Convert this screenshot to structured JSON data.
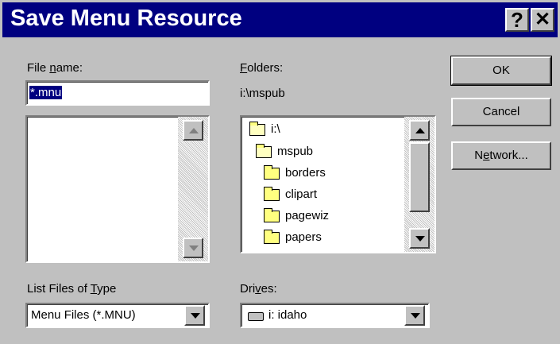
{
  "window": {
    "title": "Save Menu Resource",
    "help_glyph": "?",
    "close_glyph": "✕"
  },
  "file_name": {
    "label_pre": "File ",
    "label_u": "n",
    "label_post": "ame:",
    "value": "*.mnu",
    "files": []
  },
  "folders": {
    "label_u": "F",
    "label_post": "olders:",
    "current_path": "i:\\mspub",
    "items": [
      "i:\\",
      "mspub",
      "borders",
      "clipart",
      "pagewiz",
      "papers"
    ]
  },
  "list_type": {
    "label_pre": "List Files of ",
    "label_u": "T",
    "label_post": "ype",
    "value": "Menu Files (*.MNU)"
  },
  "drives": {
    "label_pre": "Dri",
    "label_u": "v",
    "label_post": "es:",
    "value": "i: idaho"
  },
  "buttons": {
    "ok": "OK",
    "cancel": "Cancel",
    "network_pre": "N",
    "network_u": "e",
    "network_post": "twork..."
  },
  "colors": {
    "title_bg": "#000080",
    "face": "#c0c0c0",
    "selection": "#000080"
  }
}
